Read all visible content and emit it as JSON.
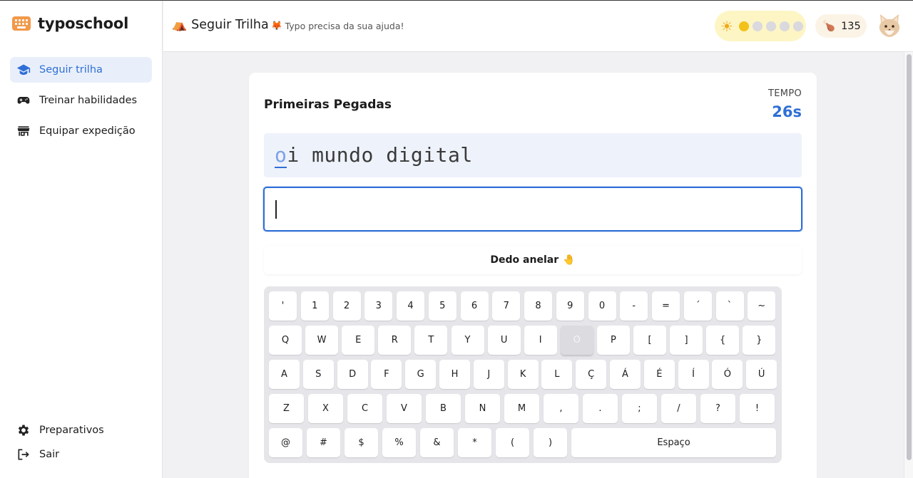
{
  "app": {
    "brand": "typoschool"
  },
  "sidebar": {
    "items": [
      {
        "label": "Seguir trilha",
        "icon": "graduation-cap-icon",
        "active": true
      },
      {
        "label": "Treinar habilidades",
        "icon": "gamepad-icon",
        "active": false
      },
      {
        "label": "Equipar expedição",
        "icon": "store-icon",
        "active": false
      }
    ],
    "bottom": [
      {
        "label": "Preparativos",
        "icon": "gear-icon"
      },
      {
        "label": "Sair",
        "icon": "logout-icon"
      }
    ]
  },
  "header": {
    "title_emoji": "⛺",
    "title": "Seguir Trilha",
    "subtitle_emoji": "🦊",
    "subtitle": "Typo precisa da sua ajuda!",
    "sun_icon": "☀",
    "energy": {
      "filled": 1,
      "total": 5
    },
    "food_icon": "🍗",
    "food_count": "135",
    "accent": "#2f6fd6"
  },
  "lesson": {
    "title": "Primeiras Pegadas",
    "timer_label": "TEMPO",
    "timer_value": "26s",
    "target_current": "o",
    "target_rest": "i mundo digital",
    "typed": "",
    "hint": "Dedo anelar",
    "hint_emoji": "🤚"
  },
  "keyboard": {
    "highlight": "O",
    "rows": [
      [
        "'",
        "1",
        "2",
        "3",
        "4",
        "5",
        "6",
        "7",
        "8",
        "9",
        "0",
        "-",
        "=",
        "´",
        "`",
        "~"
      ],
      [
        "Q",
        "W",
        "E",
        "R",
        "T",
        "Y",
        "U",
        "I",
        "O",
        "P",
        "[",
        "]",
        "{",
        "}"
      ],
      [
        "A",
        "S",
        "D",
        "F",
        "G",
        "H",
        "J",
        "K",
        "L",
        "Ç",
        "Á",
        "É",
        "Í",
        "Ó",
        "Ú"
      ],
      [
        "Z",
        "X",
        "C",
        "V",
        "B",
        "N",
        "M",
        ",",
        ".",
        ";",
        "/",
        "?",
        "!"
      ],
      [
        "@",
        "#",
        "$",
        "%",
        "&",
        "*",
        "(",
        ")",
        "Espaço"
      ]
    ]
  }
}
